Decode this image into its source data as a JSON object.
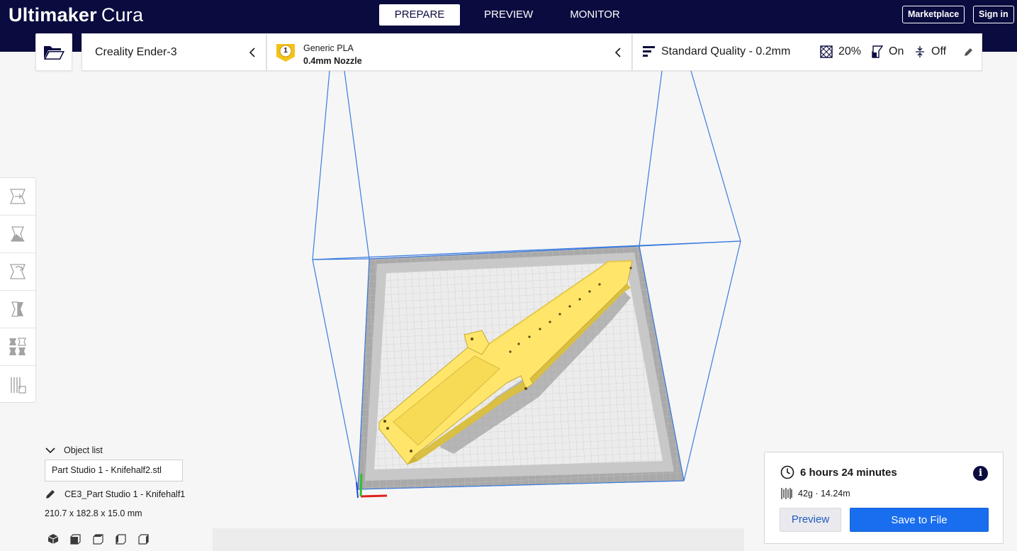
{
  "app": {
    "brand": "Ultimaker",
    "product": "Cura"
  },
  "stages": [
    {
      "label": "PREPARE",
      "active": true
    },
    {
      "label": "PREVIEW",
      "active": false
    },
    {
      "label": "MONITOR",
      "active": false
    }
  ],
  "header_buttons": {
    "marketplace": "Marketplace",
    "sign_in": "Sign in"
  },
  "toolbar": {
    "printer": "Creality Ender-3",
    "extruder_number": "1",
    "material": "Generic PLA",
    "nozzle": "0.4mm Nozzle",
    "quality": "Standard Quality - 0.2mm",
    "infill": "20%",
    "support": "On",
    "adhesion": "Off"
  },
  "tools": [
    {
      "name": "move-tool",
      "icon": "move-icon"
    },
    {
      "name": "scale-tool",
      "icon": "scale-icon"
    },
    {
      "name": "rotate-tool",
      "icon": "rotate-icon"
    },
    {
      "name": "mirror-tool",
      "icon": "mirror-icon"
    },
    {
      "name": "per-model-settings-tool",
      "icon": "per-model-settings-icon"
    },
    {
      "name": "support-blocker-tool",
      "icon": "support-blocker-icon"
    }
  ],
  "object_list": {
    "header": "Object list",
    "entry": "Part Studio 1 - Knifehalf2.stl",
    "job_name": "CE3_Part Studio 1 - Knifehalf1",
    "dimensions": "210.7 x 182.8 x 15.0 mm"
  },
  "view_buttons": [
    "3d-view-icon",
    "front-view-icon",
    "top-view-icon",
    "left-view-icon",
    "right-view-icon"
  ],
  "print_summary": {
    "time": "6 hours 24 minutes",
    "material_usage": "42g · 14.24m",
    "info_glyph": "i",
    "preview_label": "Preview",
    "save_label": "Save to File"
  },
  "colors": {
    "header_bg": "#0a0b3f",
    "accent_blue": "#196ef0",
    "model_yellow": "#ffe66b",
    "badge_yellow": "#f3c21a"
  }
}
